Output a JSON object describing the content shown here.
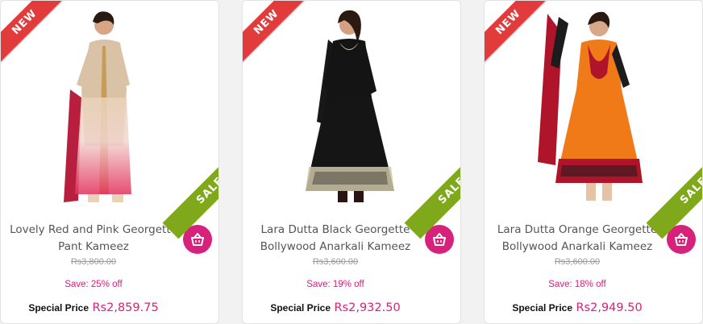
{
  "products": [
    {
      "badge_new": "NEW",
      "badge_sale": "SALE",
      "name_line1": "Lovely Red and Pink Georgette",
      "name_line2": "Pant Kameez",
      "old_price": "Rs3,800.00",
      "save": "Save: 25% off",
      "special_label": "Special Price",
      "special_price": "Rs2,859.75",
      "colors": {
        "dress_top": "#d9c2a6",
        "dress_bottom": "#e2305a",
        "accent": "#c99b5a"
      }
    },
    {
      "badge_new": "NEW",
      "badge_sale": "SALE",
      "name_line1": "Lara Dutta Black Georgette",
      "name_line2": "Bollywood Anarkali Kameez",
      "old_price": "Rs3,600.00",
      "save": "Save: 19% off",
      "special_label": "Special Price",
      "special_price": "Rs2,932.50",
      "colors": {
        "dress_top": "#141414",
        "dress_bottom": "#151515",
        "accent": "#cfc5a8"
      }
    },
    {
      "badge_new": "NEW",
      "badge_sale": "SALE",
      "name_line1": "Lara Dutta Orange Georgette",
      "name_line2": "Bollywood Anarkali Kameez",
      "old_price": "Rs3,600.00",
      "save": "Save: 18% off",
      "special_label": "Special Price",
      "special_price": "Rs2,949.50",
      "colors": {
        "dress_top": "#f07a18",
        "dress_bottom": "#f07a18",
        "accent": "#b0142a"
      }
    }
  ],
  "icons": {
    "cart": "basket-icon"
  },
  "theme": {
    "new_red": "#e23b3b",
    "sale_green": "#7fa91b",
    "pink": "#d7217b"
  }
}
